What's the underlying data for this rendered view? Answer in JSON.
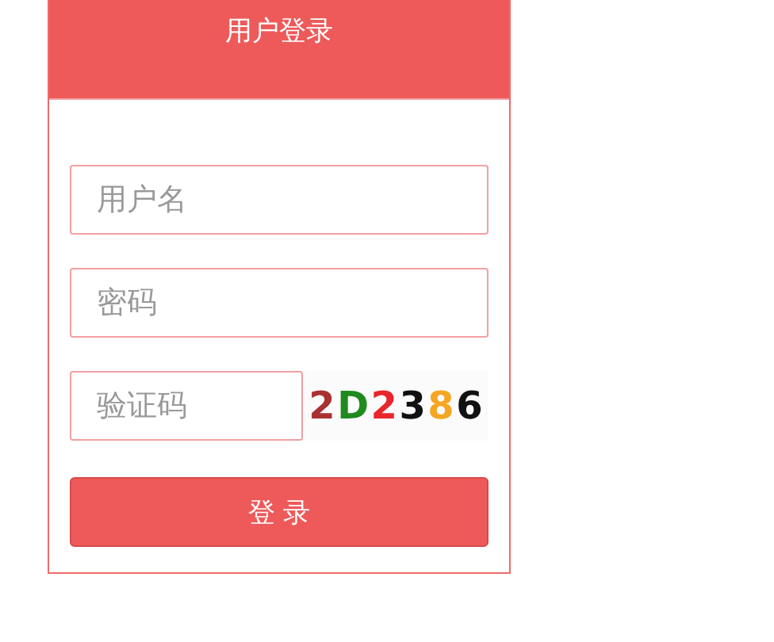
{
  "header": {
    "title": "用户登录"
  },
  "fields": [
    {
      "placeholder": "用户名"
    },
    {
      "placeholder": "密码"
    }
  ],
  "captcha": {
    "placeholder": "验证码",
    "chars": [
      {
        "char": "2",
        "color": "#a83232"
      },
      {
        "char": "D",
        "color": "#1f8a1f"
      },
      {
        "char": "2",
        "color": "#e8262b"
      },
      {
        "char": "3",
        "color": "#111111"
      },
      {
        "char": "8",
        "color": "#f5a623"
      },
      {
        "char": "6",
        "color": "#111111"
      }
    ]
  },
  "button": {
    "label": "登 录"
  }
}
